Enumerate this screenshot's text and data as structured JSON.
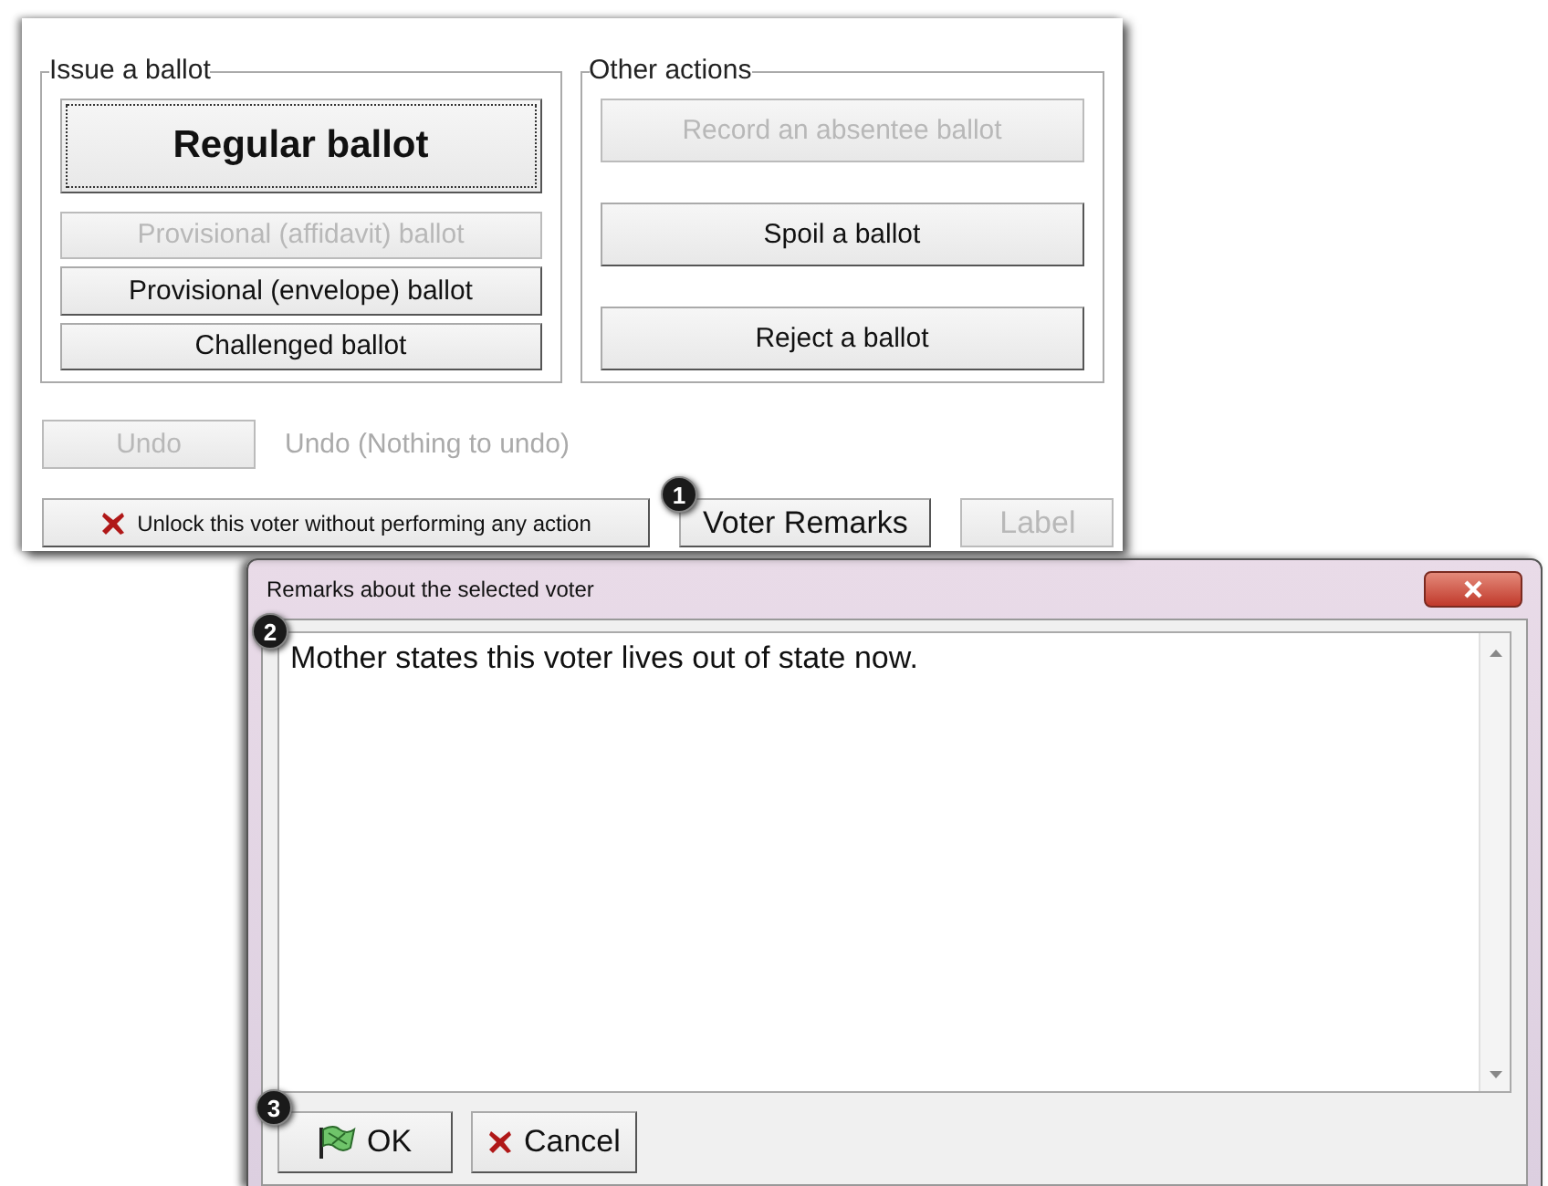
{
  "issue_group": {
    "legend": "Issue a ballot",
    "buttons": [
      {
        "label": "Regular ballot",
        "kind": "primary",
        "disabled": false
      },
      {
        "label": "Provisional (affidavit) ballot",
        "kind": "normal",
        "disabled": true
      },
      {
        "label": "Provisional (envelope) ballot",
        "kind": "normal",
        "disabled": false
      },
      {
        "label": "Challenged ballot",
        "kind": "normal",
        "disabled": false
      }
    ]
  },
  "other_group": {
    "legend": "Other actions",
    "buttons": [
      {
        "label": "Record an absentee ballot",
        "disabled": true
      },
      {
        "label": "Spoil a ballot",
        "disabled": false
      },
      {
        "label": "Reject a ballot",
        "disabled": false
      }
    ]
  },
  "undo": {
    "button": {
      "label": "Undo",
      "disabled": true
    },
    "status": "Undo (Nothing to undo)"
  },
  "bottom_buttons": [
    {
      "label": "Unlock this voter without performing any action",
      "kind": "unlock",
      "disabled": false
    },
    {
      "label": "Voter Remarks",
      "kind": "plain",
      "disabled": false,
      "callout": "1"
    },
    {
      "label": "Label",
      "kind": "plain",
      "disabled": true
    }
  ],
  "dialog": {
    "title": "Remarks about the selected voter",
    "remarks": {
      "value": "Mother states this voter lives out of state now.",
      "callout": "2"
    },
    "buttons": [
      {
        "label": "OK",
        "kind": "ok",
        "callout": "3"
      },
      {
        "label": "Cancel",
        "kind": "cancel"
      }
    ]
  }
}
